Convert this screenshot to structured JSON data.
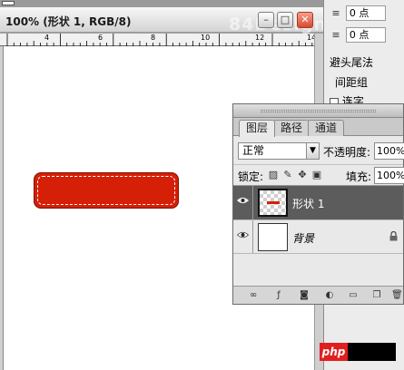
{
  "document": {
    "title": "100% (形状 1, RGB/8)",
    "watermark": "84Design.com",
    "ruler_numbers": [
      "4",
      "6",
      "8",
      "10",
      "12",
      "14"
    ],
    "window_buttons": {
      "minimize": "–",
      "maximize": "□",
      "close": "✕"
    }
  },
  "right_panel": {
    "rows": [
      {
        "icon": "≡",
        "value": "0 点"
      },
      {
        "icon": "≡",
        "value": "0 点"
      }
    ],
    "text1": "避头尾法",
    "text2": "间距组",
    "text3": "连字"
  },
  "layers_panel": {
    "tabs": [
      "图层",
      "路径",
      "通道"
    ],
    "blend_mode": "正常",
    "opacity_label": "不透明度:",
    "opacity_value": "100%",
    "lock_label": "锁定:",
    "fill_label": "填充:",
    "fill_value": "100%",
    "layers": [
      {
        "name": "形状 1",
        "selected": true
      },
      {
        "name": "背景",
        "selected": false
      }
    ]
  },
  "badge": {
    "text": "php"
  },
  "colors": {
    "shape_fill": "#d51f06",
    "selected_layer": "#5c5c5c",
    "close_button": "#d94a2f"
  }
}
